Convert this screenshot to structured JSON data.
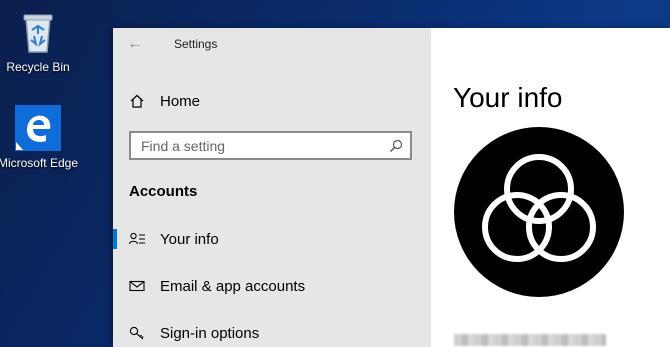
{
  "desktop": {
    "icons": [
      {
        "label": "Recycle Bin",
        "icon": "recycle-bin-icon"
      },
      {
        "label": "Microsoft Edge",
        "icon": "edge-icon"
      }
    ]
  },
  "settings": {
    "title": "Settings",
    "home_label": "Home",
    "search_placeholder": "Find a setting",
    "section_heading": "Accounts",
    "nav_items": [
      {
        "label": "Your info",
        "icon": "person-icon",
        "selected": true
      },
      {
        "label": "Email & app accounts",
        "icon": "mail-icon",
        "selected": false
      },
      {
        "label": "Sign-in options",
        "icon": "key-icon",
        "selected": false
      }
    ],
    "content": {
      "title": "Your info"
    }
  },
  "colors": {
    "accent": "#0078d7",
    "sidebar_bg": "#e6e6e6",
    "content_bg": "#ffffff",
    "avatar_bg": "#000000"
  }
}
